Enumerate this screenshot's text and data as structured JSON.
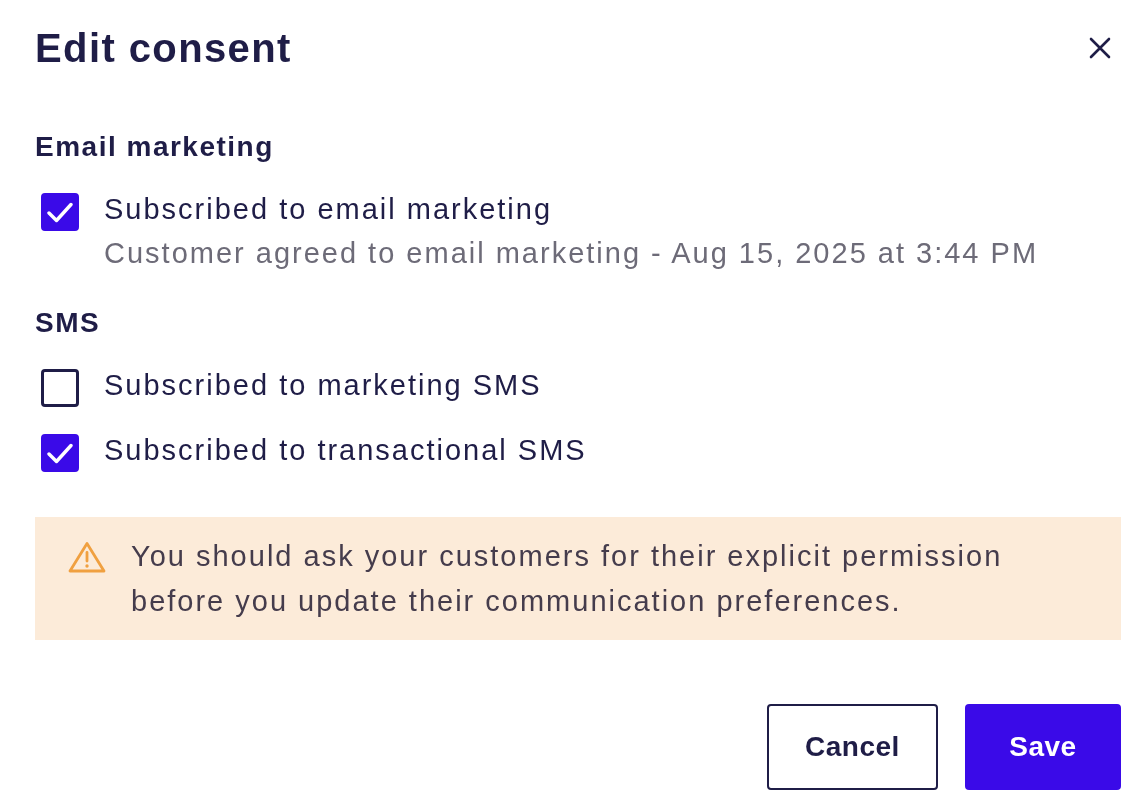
{
  "dialog": {
    "title": "Edit consent"
  },
  "sections": [
    {
      "heading": "Email marketing",
      "options": [
        {
          "label": "Subscribed to email marketing",
          "checked": true,
          "note": "Customer agreed to email marketing - Aug 15, 2025 at 3:44 PM"
        }
      ]
    },
    {
      "heading": "SMS",
      "options": [
        {
          "label": "Subscribed to marketing SMS",
          "checked": false
        },
        {
          "label": "Subscribed to transactional SMS",
          "checked": true
        }
      ]
    }
  ],
  "warning": {
    "text": "You should ask your customers for their explicit permission before you update their communication preferences."
  },
  "buttons": [
    {
      "label": "Cancel",
      "kind": "secondary"
    },
    {
      "label": "Save",
      "kind": "primary"
    }
  ]
}
